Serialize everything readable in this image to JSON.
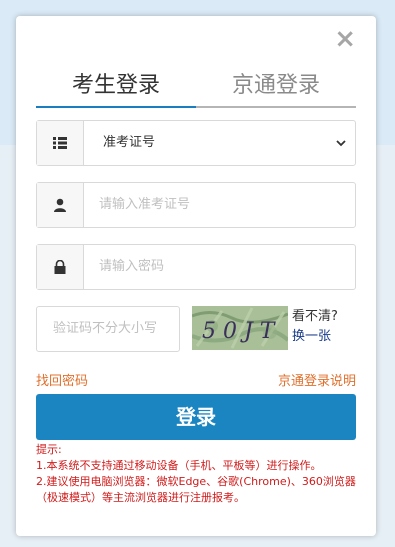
{
  "dialog": {
    "close_glyph": "×",
    "tabs": [
      {
        "label": "考生登录",
        "active": true
      },
      {
        "label": "京通登录",
        "active": false
      }
    ]
  },
  "form": {
    "select": {
      "value": "准考证号"
    },
    "fields": {
      "username_placeholder": "请输入准考证号",
      "password_placeholder": "请输入密码"
    },
    "captcha": {
      "placeholder": "验证码不分大小写",
      "image_text": "5 0 J T",
      "unclear": "看不清?",
      "refresh": "换一张"
    }
  },
  "links": {
    "forgot": "找回密码",
    "jingtong_help": "京通登录说明"
  },
  "submit": {
    "label": "登录"
  },
  "tips": {
    "title": "提示:",
    "items": [
      "1.本系统不支持通过移动设备（手机、平板等）进行操作。",
      "2.建议使用电脑浏览器：微软Edge、谷歌(Chrome)、360浏览器（极速模式）等主流浏览器进行注册报考。"
    ]
  },
  "colors": {
    "accent": "#1b85c2",
    "warning": "#d01b1b",
    "link": "#e0702d"
  }
}
